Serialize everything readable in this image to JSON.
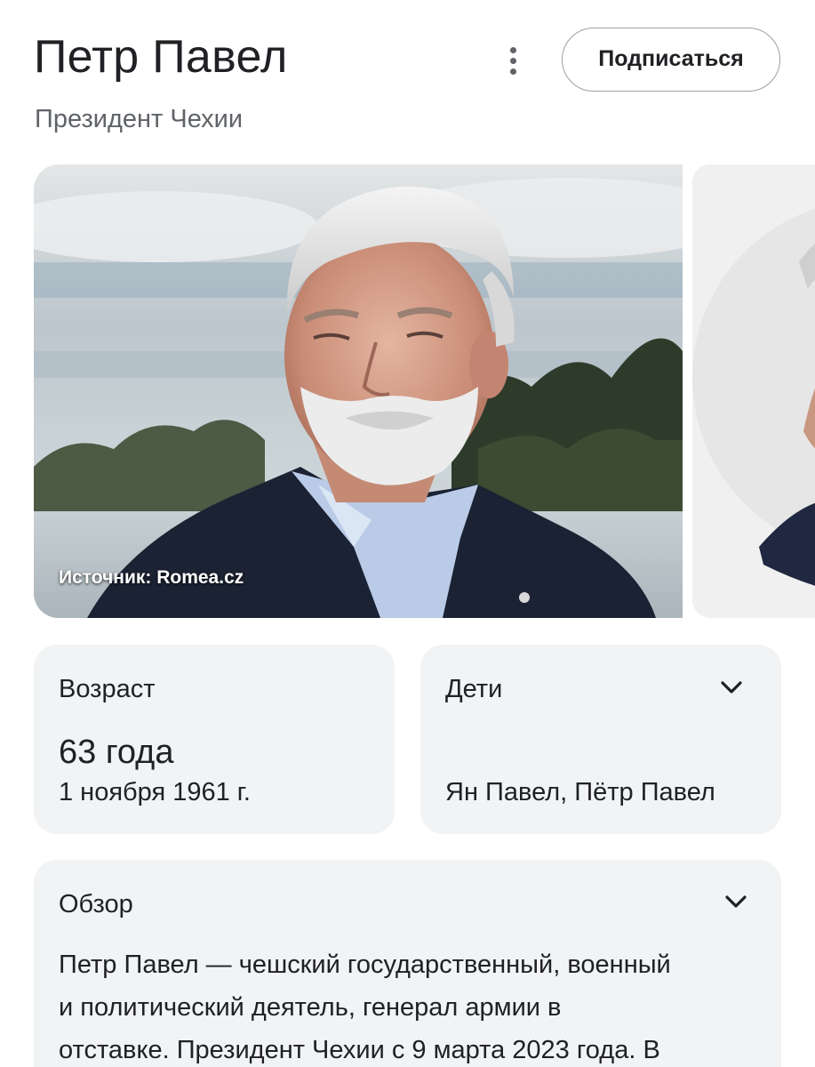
{
  "header": {
    "title": "Петр Павел",
    "subtitle": "Президент Чехии",
    "subscribe_label": "Подписаться",
    "more_icon": "more-vert-icon"
  },
  "images": {
    "main_caption": "Источник: Romea.cz"
  },
  "facts": {
    "age": {
      "label": "Возраст",
      "value": "63 года",
      "birth_date": "1 ноября 1961 г."
    },
    "children": {
      "label": "Дети",
      "value": "Ян Павел, Пётр Павел",
      "expand_icon": "chevron-down-icon"
    }
  },
  "overview": {
    "label": "Обзор",
    "expand_icon": "chevron-down-icon",
    "lines": [
      "Петр Павел — чешский государственный, военный",
      "и политический деятель, генерал армии в",
      "отставке. Президент Чехии с 9 марта 2023 года. В"
    ]
  },
  "colors": {
    "card_background": "#f1f3f4",
    "text_primary": "#202124",
    "text_secondary": "#5f6368",
    "button_border": "#9aa0a6"
  }
}
